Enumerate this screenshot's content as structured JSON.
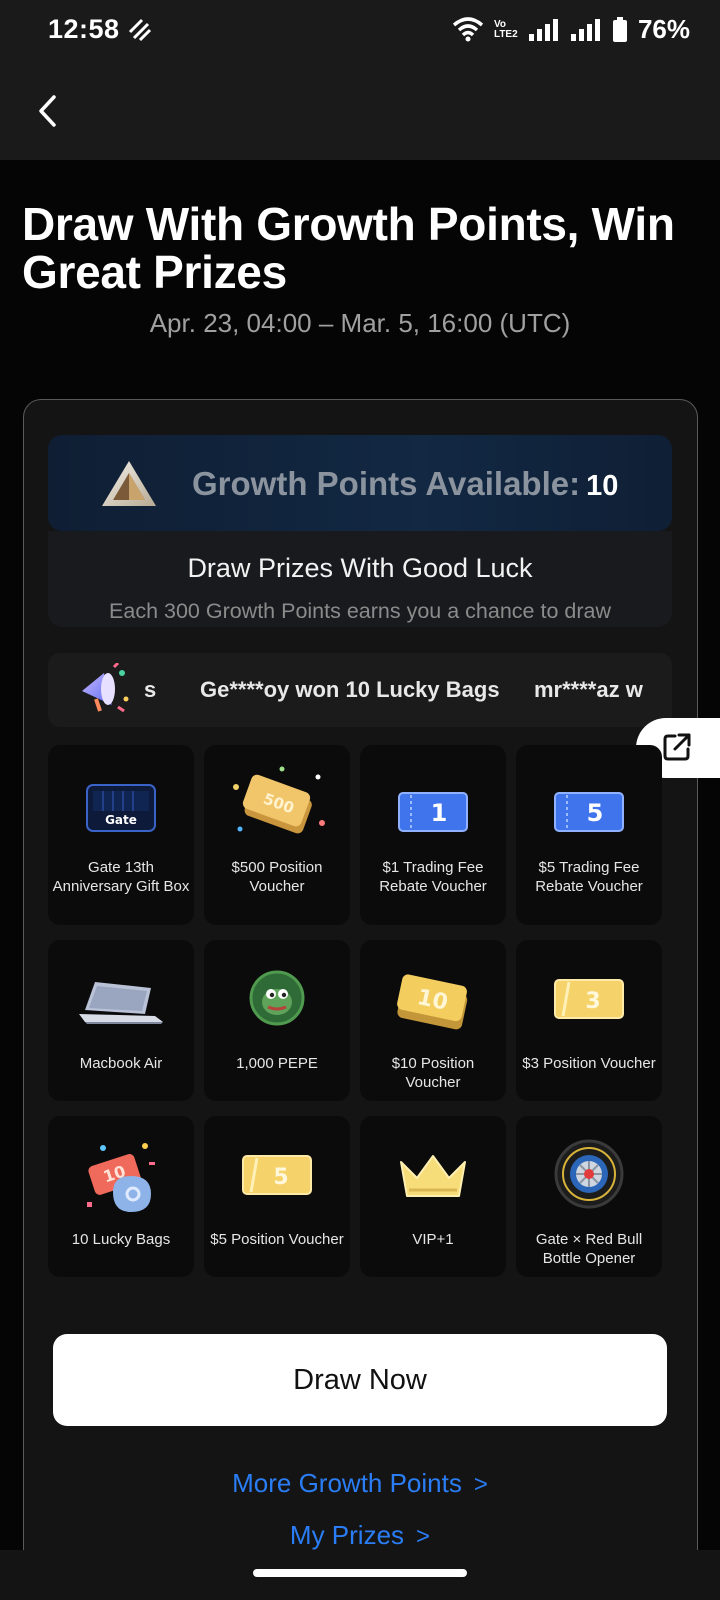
{
  "status_bar": {
    "time": "12:58",
    "network_label": "Vo LTE2",
    "battery": "76%"
  },
  "header": {
    "title": "Draw With Growth Points, Win Great Prizes",
    "date_range": "Apr. 23, 04:00 – Mar. 5, 16:00 (UTC)"
  },
  "points": {
    "label": "Growth Points Available:",
    "value": "10"
  },
  "draw_info": {
    "title": "Draw Prizes With Good Luck",
    "subtitle": "Each 300 Growth Points earns you a chance to draw"
  },
  "ticker": {
    "items": [
      "s",
      "Ge****oy won 10 Lucky Bags",
      "mr****az w"
    ]
  },
  "prizes": [
    {
      "label": "Gate 13th Anniversary Gift Box",
      "icon": "gift-box-icon"
    },
    {
      "label": "$500 Position Voucher",
      "icon": "voucher-500-icon",
      "badge": "500"
    },
    {
      "label": "$1 Trading Fee Rebate Voucher",
      "icon": "ticket-1-icon",
      "badge": "1"
    },
    {
      "label": "$5 Trading Fee Rebate Voucher",
      "icon": "ticket-5-icon",
      "badge": "5"
    },
    {
      "label": "Macbook Air",
      "icon": "laptop-icon"
    },
    {
      "label": "1,000 PEPE",
      "icon": "pepe-coin-icon"
    },
    {
      "label": "$10 Position Voucher",
      "icon": "voucher-10-icon",
      "badge": "10"
    },
    {
      "label": "$3 Position Voucher",
      "icon": "voucher-3-icon",
      "badge": "3"
    },
    {
      "label": "10 Lucky Bags",
      "icon": "lucky-bags-icon",
      "badge": "10"
    },
    {
      "label": "$5 Position Voucher",
      "icon": "voucher-5-icon",
      "badge": "5"
    },
    {
      "label": "VIP+1",
      "icon": "crown-icon"
    },
    {
      "label": "Gate × Red Bull Bottle Opener",
      "icon": "tire-icon"
    }
  ],
  "gift_box_brand": "Gate",
  "actions": {
    "draw_now": "Draw Now",
    "more_points": "More Growth Points",
    "my_prizes": "My Prizes",
    "chevron": ">"
  },
  "colors": {
    "accent_link": "#2a7df5",
    "voucher_gold": "#f5d36a",
    "ticket_blue": "#3f74ec"
  }
}
